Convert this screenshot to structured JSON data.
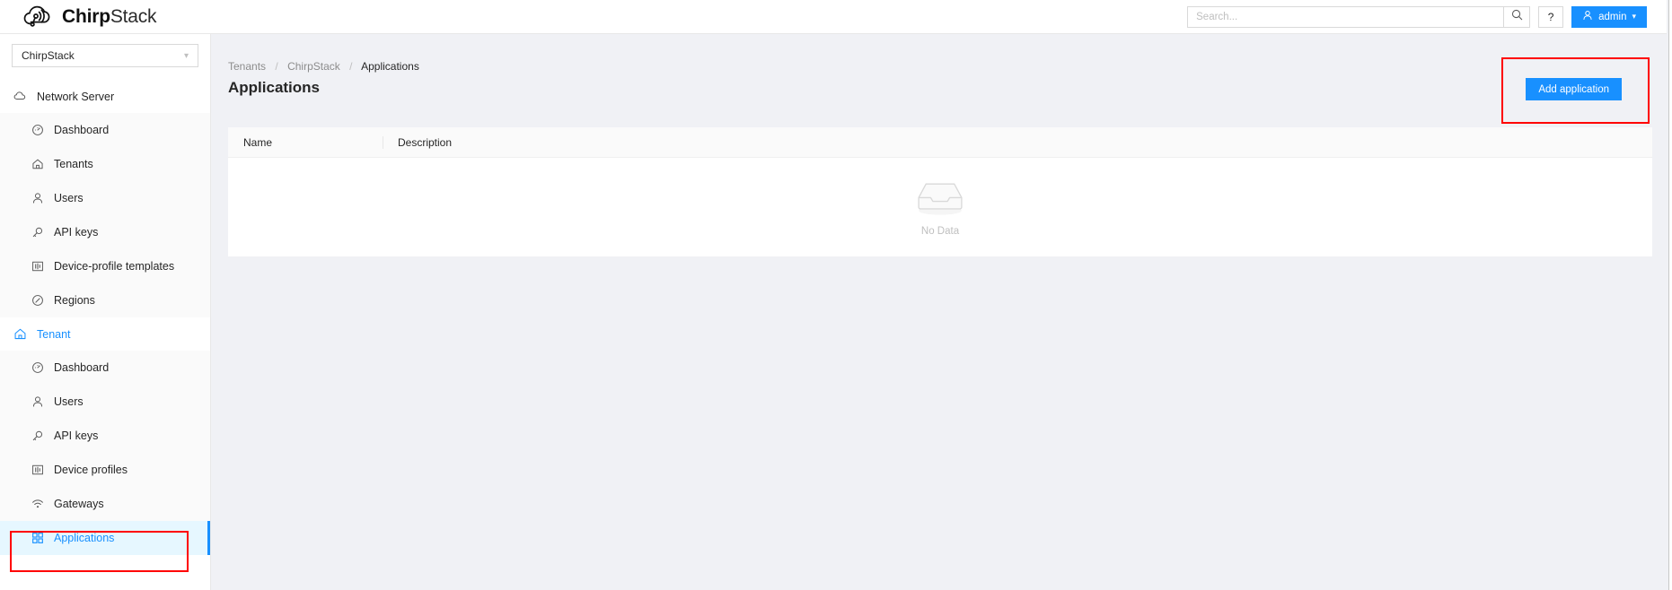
{
  "brand": {
    "name_bold": "Chirp",
    "name_light": "Stack",
    "logo_icon": "cloud-signal-icon"
  },
  "topbar": {
    "search": {
      "placeholder": "Search...",
      "value": "",
      "icon": "search-icon"
    },
    "help_label": "?",
    "account": {
      "label": "admin",
      "icon": "user-icon",
      "chevron": "chevron-down-icon",
      "color": "#1890ff"
    }
  },
  "sidebar": {
    "tenant_selector": {
      "value": "ChirpStack",
      "chevron": "chevron-down-icon"
    },
    "groups": [
      {
        "label": "Network Server",
        "icon": "cloud-icon",
        "active": false,
        "items": [
          {
            "label": "Dashboard",
            "icon": "dashboard-gauge-icon",
            "selected": false
          },
          {
            "label": "Tenants",
            "icon": "home-icon",
            "selected": false
          },
          {
            "label": "Users",
            "icon": "user-icon",
            "selected": false
          },
          {
            "label": "API keys",
            "icon": "key-icon",
            "selected": false
          },
          {
            "label": "Device-profile templates",
            "icon": "device-profile-icon",
            "selected": false
          },
          {
            "label": "Regions",
            "icon": "compass-icon",
            "selected": false
          }
        ]
      },
      {
        "label": "Tenant",
        "icon": "home-icon",
        "active": true,
        "items": [
          {
            "label": "Dashboard",
            "icon": "dashboard-gauge-icon",
            "selected": false
          },
          {
            "label": "Users",
            "icon": "user-icon",
            "selected": false
          },
          {
            "label": "API keys",
            "icon": "key-icon",
            "selected": false
          },
          {
            "label": "Device profiles",
            "icon": "device-profile-icon",
            "selected": false
          },
          {
            "label": "Gateways",
            "icon": "wifi-icon",
            "selected": false
          },
          {
            "label": "Applications",
            "icon": "grid-apps-icon",
            "selected": true
          }
        ]
      }
    ]
  },
  "main": {
    "breadcrumb": [
      {
        "label": "Tenants",
        "current": false
      },
      {
        "label": "ChirpStack",
        "current": false
      },
      {
        "label": "Applications",
        "current": true
      }
    ],
    "title": "Applications",
    "add_button": "Add application",
    "table": {
      "columns": [
        "Name",
        "Description"
      ],
      "rows": [],
      "empty_text": "No Data",
      "empty_icon": "inbox-empty-icon"
    }
  },
  "annotations": {
    "highlight_color": "#ff0000",
    "boxes": [
      "sidebar-applications",
      "add-application-button"
    ]
  }
}
